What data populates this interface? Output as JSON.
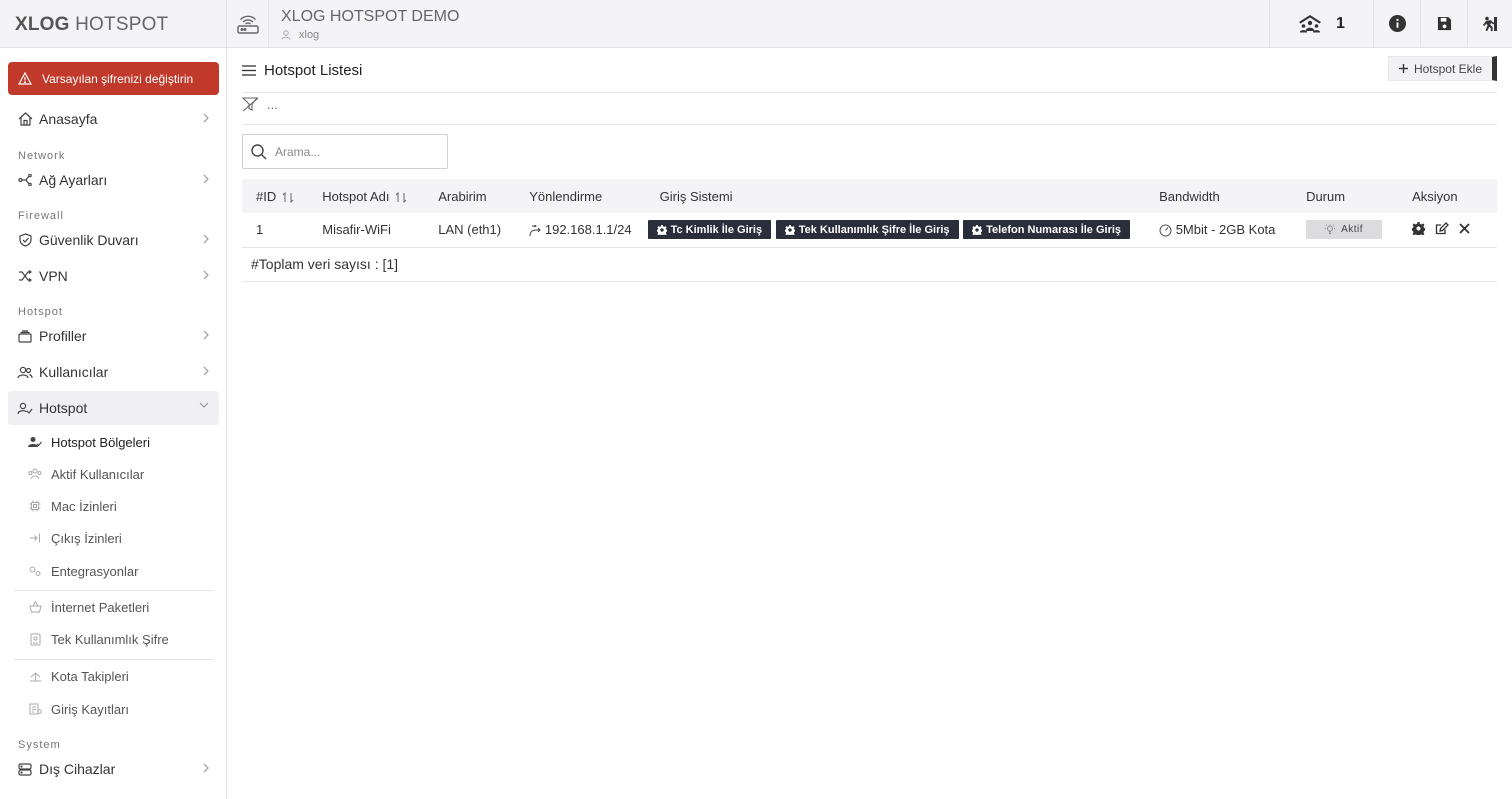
{
  "app": {
    "brand_bold": "XLOG",
    "brand_rest": " HOTSPOT",
    "device_title": "XLOG HOTSPOT DEMO",
    "device_user": "xlog",
    "connected_count": "1"
  },
  "sidebar": {
    "warning": "Varsayılan şifrenizi değiştirin",
    "home": "Anasayfa",
    "sections": {
      "network": "Network",
      "firewall": "Firewall",
      "hotspot": "Hotspot",
      "system": "System"
    },
    "items": {
      "network_settings": "Ağ Ayarları",
      "firewall": "Güvenlik Duvarı",
      "vpn": "VPN",
      "profiles": "Profiller",
      "users": "Kullanıcılar",
      "hotspot": "Hotspot",
      "external_devices": "Dış Cihazlar"
    },
    "hotspot_sub": [
      "Hotspot Bölgeleri",
      "Aktif Kullanıcılar",
      "Mac İzinleri",
      "Çıkış İzinleri",
      "Entegrasyonlar",
      "İnternet Paketleri",
      "Tek Kullanımlık Şifre",
      "Kota Takipleri",
      "Giriş Kayıtları"
    ]
  },
  "main": {
    "title": "Hotspot Listesi",
    "add_label": "Hotspot Ekle",
    "filter_text": "...",
    "search_placeholder": "Arama...",
    "columns": [
      "#ID",
      "Hotspot Adı",
      "Arabirim",
      "Yönlendirme",
      "Giriş Sistemi",
      "Bandwidth",
      "Durum",
      "Aksiyon"
    ],
    "rows": [
      {
        "id": "1",
        "name": "Misafir-WiFi",
        "interface": "LAN (eth1)",
        "routing": "192.168.1.1/24",
        "login_systems": [
          "Tc Kimlik İle Giriş",
          "Tek Kullanımlık Şifre İle Giriş",
          "Telefon Numarası İle Giriş"
        ],
        "bandwidth": "5Mbit - 2GB Kota",
        "status": "Aktif"
      }
    ],
    "total_text": "#Toplam veri sayısı : [1]"
  },
  "colors": {
    "warning_bg": "#c0392b",
    "dark_button": "#2a2d3a",
    "header_bg": "#f4f4f6"
  }
}
